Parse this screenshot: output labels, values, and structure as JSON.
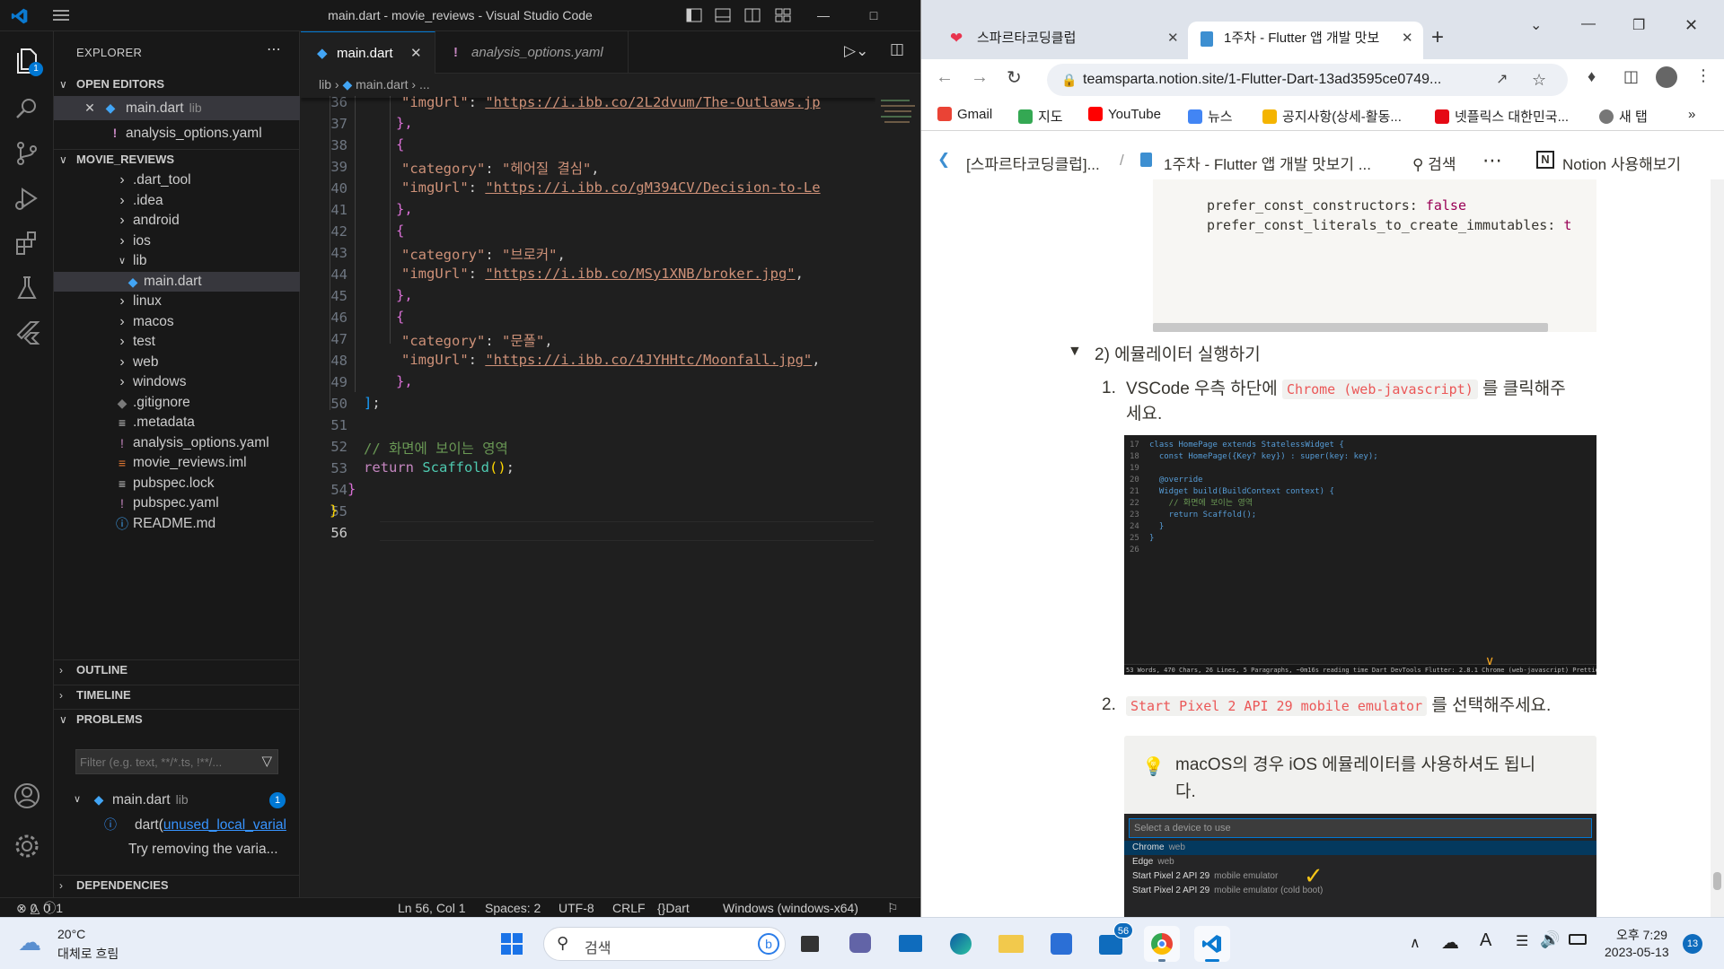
{
  "vscode": {
    "title": "main.dart - movie_reviews - Visual Studio Code",
    "explorer_label": "EXPLORER",
    "open_editors_label": "OPEN EDITORS",
    "open_editors": [
      {
        "name": "main.dart",
        "desc": "lib"
      },
      {
        "name": "analysis_options.yaml",
        "desc": ""
      }
    ],
    "project_label": "MOVIE_REVIEWS",
    "tree": [
      ".dart_tool",
      ".idea",
      "android",
      "ios",
      "lib",
      "main.dart",
      "linux",
      "macos",
      "test",
      "web",
      "windows",
      ".gitignore",
      ".metadata",
      "analysis_options.yaml",
      "movie_reviews.iml",
      "pubspec.lock",
      "pubspec.yaml",
      "README.md"
    ],
    "outline_label": "OUTLINE",
    "timeline_label": "TIMELINE",
    "problems_label": "PROBLEMS",
    "filter_placeholder": "Filter (e.g. text, **/*.ts, !**/...",
    "problem_file": "main.dart",
    "problem_file_dir": "lib",
    "problem_count": "1",
    "problem_source": "dart(",
    "problem_code": "unused_local_varial",
    "problem_hint": "Try removing the varia...",
    "dependencies_label": "DEPENDENCIES",
    "explorer_badge": "1",
    "tabs": [
      {
        "label": "main.dart"
      },
      {
        "label": "analysis_options.yaml"
      }
    ],
    "breadcrumb": [
      "lib",
      "main.dart",
      "..."
    ],
    "line_numbers": [
      "36",
      "37",
      "38",
      "39",
      "40",
      "41",
      "42",
      "43",
      "44",
      "45",
      "46",
      "47",
      "48",
      "49",
      "50",
      "51",
      "52",
      "53",
      "54",
      "55",
      "56"
    ],
    "current_line": "56",
    "code": {
      "l36_key": "\"imgUrl\"",
      "l36_val": "\"https://i.ibb.co/2L2dvum/The-Outlaws.jp",
      "cat1_key": "\"category\"",
      "cat1_val": "\"헤어질 결심\"",
      "img1_key": "\"imgUrl\"",
      "img1_val": "\"https://i.ibb.co/gM394CV/Decision-to-Le",
      "cat2_key": "\"category\"",
      "cat2_val": "\"브로커\"",
      "img2_key": "\"imgUrl\"",
      "img2_val": "\"https://i.ibb.co/MSy1XNB/broker.jpg\"",
      "cat3_key": "\"category\"",
      "cat3_val": "\"문폴\"",
      "img3_key": "\"imgUrl\"",
      "img3_val": "\"https://i.ibb.co/4JYHHtc/Moonfall.jpg\"",
      "comment": "// 화면에 보이는 영역",
      "return_kw": "return",
      "scaffold": "Scaffold",
      "tail": ";"
    },
    "status": {
      "errors": "0",
      "warnings": "0",
      "infos": "1",
      "position": "Ln 56, Col 1",
      "spaces": "Spaces: 2",
      "encoding": "UTF-8",
      "eol": "CRLF",
      "language": "Dart",
      "device": "Windows (windows-x64)"
    }
  },
  "chrome": {
    "tabs": [
      {
        "label": "스파르타코딩클럽"
      },
      {
        "label": "1주차 - Flutter 앱 개발 맛보"
      }
    ],
    "url": "teamsparta.notion.site/1-Flutter-Dart-13ad3595ce0749...",
    "bookmarks": [
      "Gmail",
      "지도",
      "YouTube",
      "뉴스",
      "공지사항(상세-활동...",
      "넷플릭스 대한민국...",
      "새 탭"
    ],
    "notion_crumb1": "[스파르타코딩클럽]...",
    "notion_crumb2": "1주차 - Flutter 앱 개발 맛보기 ...",
    "notion_search": "검색",
    "notion_try": "Notion 사용해보기",
    "code_line1_key": "prefer_const_constructors",
    "code_line1_val": "false",
    "code_line2_key": "prefer_const_literals_to_create_immutables",
    "code_line2_val": "t",
    "toggle_heading": "2) 에뮬레이터 실행하기",
    "step1_num": "1.",
    "step1_pre": "VSCode 우측 하단에",
    "step1_code": "Chrome (web-javascript)",
    "step1_post": "를 클릭해주",
    "step1_cont": "세요.",
    "step2_num": "2.",
    "step2_code": "Start Pixel 2 API 29 mobile emulator",
    "step2_post": "를 선택해주세요.",
    "callout": "macOS의 경우 iOS 에뮬레이터를 사용하셔도 됩니",
    "callout_cont": "다.",
    "shot1_lines": [
      {
        "n": "17",
        "t": "class HomePage extends StatelessWidget {"
      },
      {
        "n": "18",
        "t": "  const HomePage({Key? key}) : super(key: key);"
      },
      {
        "n": "19",
        "t": ""
      },
      {
        "n": "20",
        "t": "  @override"
      },
      {
        "n": "21",
        "t": "  Widget build(BuildContext context) {"
      },
      {
        "n": "22",
        "t": "    // 화면에 보이는 영역"
      },
      {
        "n": "23",
        "t": "    return Scaffold();"
      },
      {
        "n": "24",
        "t": "  }"
      },
      {
        "n": "25",
        "t": "}"
      },
      {
        "n": "26",
        "t": ""
      }
    ],
    "shot1_status": "53 Words, 470 Chars, 26 Lines, 5 Paragraphs, ~0m16s reading time      Dart DevTools   Flutter: 2.8.1   Chrome (web-javascript)   Prettier",
    "shot2_placeholder": "Select a device to use",
    "shot2_items": [
      {
        "name": "Chrome",
        "tag": "web"
      },
      {
        "name": "Edge",
        "tag": "web"
      },
      {
        "name": "Start Pixel 2 API 29",
        "tag": "mobile emulator"
      },
      {
        "name": "Start Pixel 2 API 29",
        "tag": "mobile emulator (cold boot)"
      }
    ]
  },
  "taskbar": {
    "weather_temp": "20°C",
    "weather_desc": "대체로 흐림",
    "search": "검색",
    "store_badge": "56",
    "time": "오후 7:29",
    "date": "2023-05-13",
    "notif_count": "13"
  },
  "colors": {
    "vscode_accent": "#0078d4",
    "notion_code": "#eb5757"
  }
}
